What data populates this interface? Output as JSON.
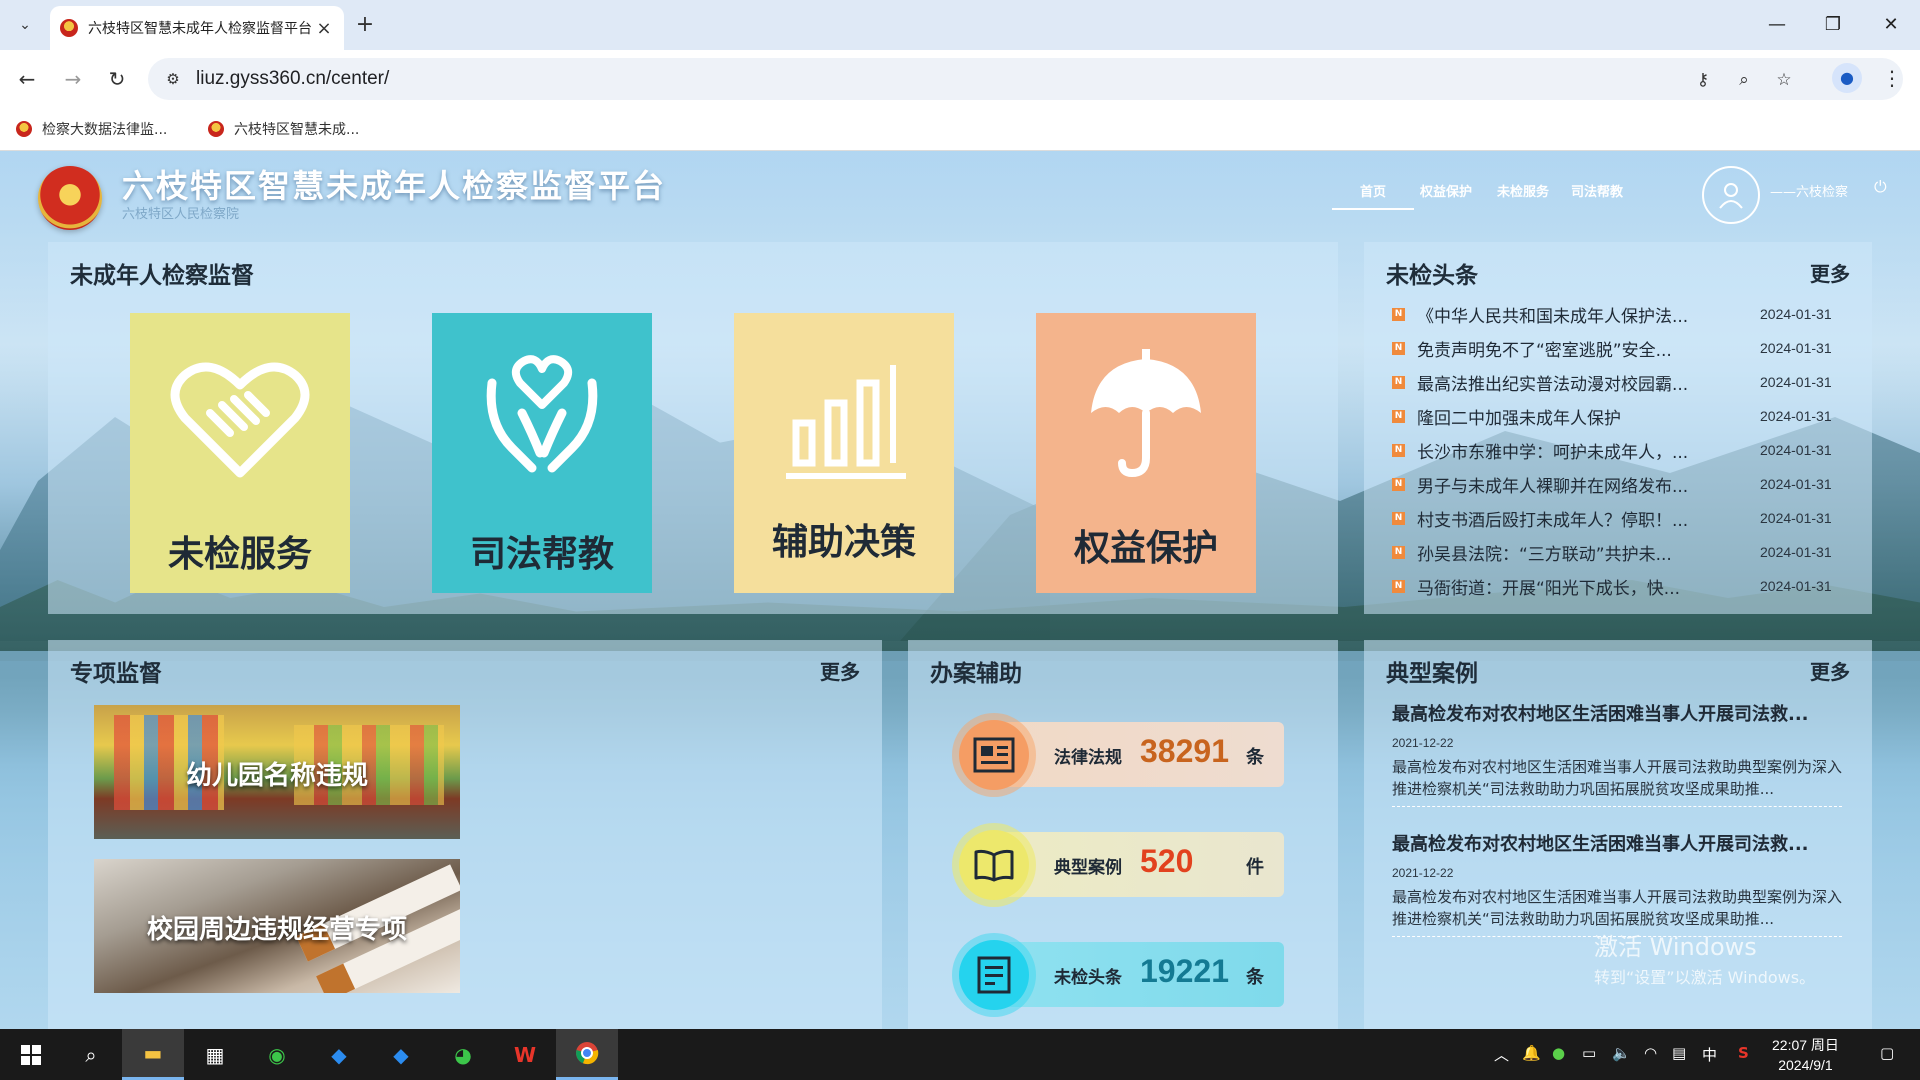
{
  "browser": {
    "tab_title": "六枝特区智慧未成年人检察监督平台",
    "url": "liuz.gyss360.cn/center/",
    "bookmarks": [
      "检察大数据法律监...",
      "六枝特区智慧未成..."
    ]
  },
  "header": {
    "title": "六枝特区智慧未成年人检察监督平台",
    "subtitle": "六枝特区人民检察院",
    "nav": [
      "首页",
      "权益保护",
      "未检服务",
      "司法帮教"
    ],
    "user": "——六枝检察"
  },
  "supervision": {
    "title": "未成年人检察监督",
    "tiles": [
      {
        "label": "未检服务",
        "color": "#e6e48a",
        "icon": "heart-handshake-icon"
      },
      {
        "label": "司法帮教",
        "color": "#3fc2cc",
        "icon": "heart-hands-icon"
      },
      {
        "label": "辅助决策",
        "color": "#f5df9c",
        "icon": "bar-chart-icon"
      },
      {
        "label": "权益保护",
        "color": "#f4b48c",
        "icon": "umbrella-icon"
      }
    ]
  },
  "headlines": {
    "title": "未检头条",
    "more": "更多",
    "items": [
      {
        "title": "《中华人民共和国未成年人保护法...",
        "date": "2024-01-31"
      },
      {
        "title": "免责声明免不了“密室逃脱”安全...",
        "date": "2024-01-31"
      },
      {
        "title": "最高法推出纪实普法动漫对校园霸...",
        "date": "2024-01-31"
      },
      {
        "title": "隆回二中加强未成年人保护",
        "date": "2024-01-31"
      },
      {
        "title": "长沙市东雅中学：呵护未成年人，...",
        "date": "2024-01-31"
      },
      {
        "title": "男子与未成年人裸聊并在网络发布...",
        "date": "2024-01-31"
      },
      {
        "title": "村支书酒后殴打未成年人？停职！...",
        "date": "2024-01-31"
      },
      {
        "title": "孙吴县法院：“三方联动”共护未...",
        "date": "2024-01-31"
      },
      {
        "title": "马衙街道：开展“阳光下成长，快...",
        "date": "2024-01-31"
      }
    ]
  },
  "special": {
    "title": "专项监督",
    "more": "更多",
    "cards": [
      {
        "label": "幼儿园名称违规"
      },
      {
        "label": "校园周边违规经营专项"
      }
    ]
  },
  "assist": {
    "title": "办案辅助",
    "stats": [
      {
        "label": "法律法规",
        "value": "38291",
        "unit": "条",
        "value_color": "#c8641e",
        "icon": "newspaper-icon"
      },
      {
        "label": "典型案例",
        "value": "520",
        "unit": "件",
        "value_color": "#e2421e",
        "icon": "book-icon"
      },
      {
        "label": "未检头条",
        "value": "19221",
        "unit": "条",
        "value_color": "#147a93",
        "icon": "list-document-icon"
      }
    ]
  },
  "cases": {
    "title": "典型案例",
    "more": "更多",
    "items": [
      {
        "title": "最高检发布对农村地区生活困难当事人开展司法救...",
        "date": "2021-12-22",
        "desc": "最高检发布对农村地区生活困难当事人开展司法救助典型案例为深入推进检察机关“司法救助助力巩固拓展脱贫攻坚成果助推..."
      },
      {
        "title": "最高检发布对农村地区生活困难当事人开展司法救...",
        "date": "2021-12-22",
        "desc": "最高检发布对农村地区生活困难当事人开展司法救助典型案例为深入推进检察机关“司法救助助力巩固拓展脱贫攻坚成果助推..."
      }
    ]
  },
  "watermark": {
    "line1": "激活 Windows",
    "line2": "转到“设置”以激活 Windows。"
  },
  "taskbar": {
    "ime": "中",
    "time": "22:07 周日",
    "date": "2024/9/1"
  }
}
